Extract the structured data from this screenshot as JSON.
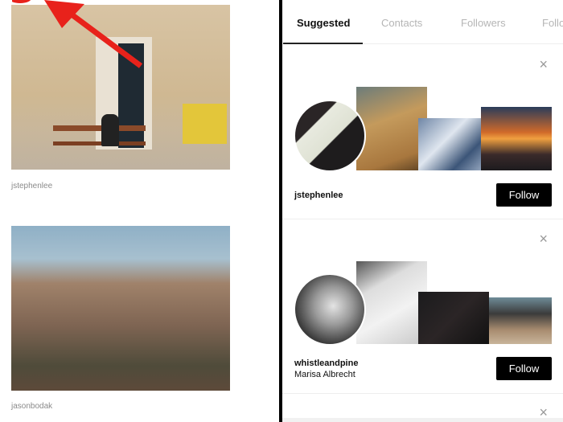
{
  "left_feed": {
    "posts": [
      {
        "username": "jstephenlee"
      },
      {
        "username": "jasonbodak"
      }
    ]
  },
  "tabs": [
    {
      "label": "Suggested",
      "active": true
    },
    {
      "label": "Contacts"
    },
    {
      "label": "Followers"
    },
    {
      "label": "Following"
    }
  ],
  "suggestions": [
    {
      "username": "jstephenlee",
      "name": "",
      "follow_label": "Follow"
    },
    {
      "username": "whistleandpine",
      "name": "Marisa Albrecht",
      "follow_label": "Follow"
    }
  ],
  "close_icon": "×",
  "colors": {
    "annotation_arrow": "#e8221b",
    "follow_button": "#000000"
  }
}
